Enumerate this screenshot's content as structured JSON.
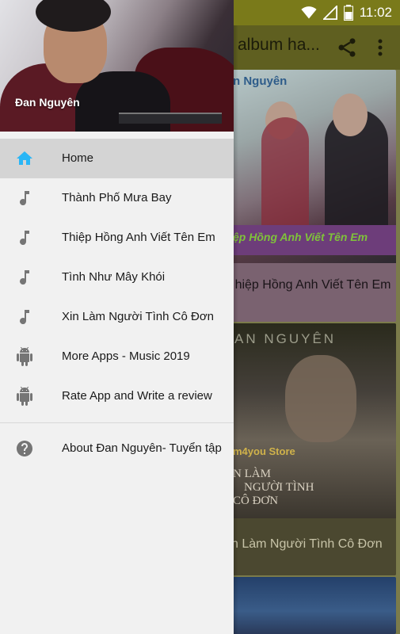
{
  "status_bar": {
    "time": "11:02",
    "icons": [
      "wifi-icon",
      "signal-icon",
      "battery-icon"
    ]
  },
  "background_app": {
    "toolbar_title": "album ha...",
    "icons": [
      "share-icon",
      "more-vert-icon"
    ],
    "cards": [
      {
        "art_top_text": "n Nguyên",
        "art_banner_text": "ệp Hồng Anh Viết Tên Em",
        "caption": "hiệp Hồng Anh Viết Tên Em"
      },
      {
        "art_top_text": "AN  NGUYÊN",
        "art_store_text": "m4you Store",
        "art_title_line1": "N LÀM",
        "art_title_line2": "NGƯỜI TÌNH",
        "art_title_line3": "CÔ ĐƠN",
        "caption": "n Làm Người Tình Cô Đơn"
      }
    ]
  },
  "drawer": {
    "header_name": "Đan Nguyên",
    "items": [
      {
        "label": "Home",
        "icon": "home-icon",
        "active": true
      },
      {
        "label": "Thành Phố Mưa Bay",
        "icon": "music-note-icon"
      },
      {
        "label": "Thiệp Hồng Anh Viết Tên Em",
        "icon": "music-note-icon"
      },
      {
        "label": "Tình Như Mây Khói",
        "icon": "music-note-icon"
      },
      {
        "label": "Xin Làm Người Tình Cô Đơn",
        "icon": "music-note-icon"
      },
      {
        "label": "More Apps - Music 2019",
        "icon": "android-icon"
      },
      {
        "label": "Rate App and Write a review",
        "icon": "android-icon"
      }
    ],
    "footer_items": [
      {
        "label": "About Đan Nguyên- Tuyển tập",
        "icon": "help-icon"
      }
    ],
    "colors": {
      "accent": "#29b6f6",
      "icon_gray": "#757575",
      "active_bg": "#d4d4d4"
    }
  }
}
